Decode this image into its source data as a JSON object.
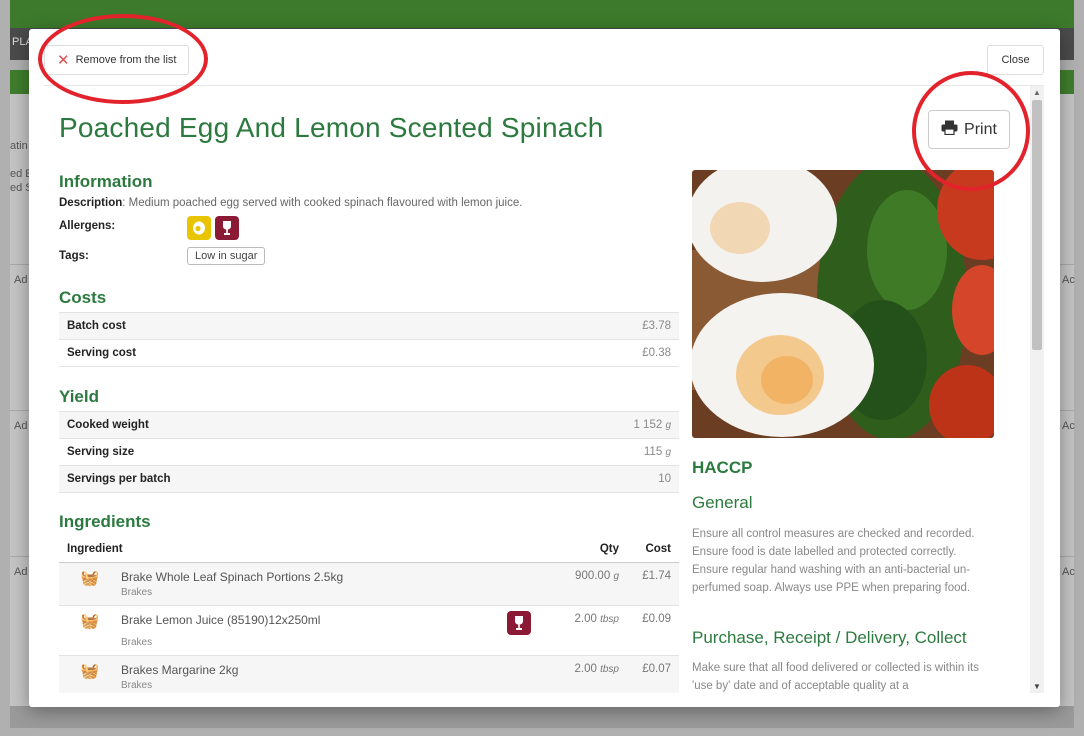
{
  "background": {
    "left_texts": [
      "atin",
      "ed E",
      "ed S",
      "Ad",
      "Ad",
      "Ad"
    ],
    "right_texts": [
      "Ac",
      "Ac",
      "Ac"
    ],
    "nav_fragment": "PLA"
  },
  "modal": {
    "remove_label": "Remove from the list",
    "close_label": "Close",
    "print_label": "Print",
    "title": "Poached Egg And Lemon Scented Spinach"
  },
  "information": {
    "heading": "Information",
    "description_label": "Description",
    "description": ": Medium poached egg served with cooked spinach flavoured with lemon juice.",
    "allergens_label": "Allergens:",
    "allergens": [
      {
        "name": "egg-allergen",
        "color": "#e9c500"
      },
      {
        "name": "sulphites-allergen",
        "color": "#8b1b35"
      }
    ],
    "tags_label": "Tags:",
    "tags": [
      "Low in sugar"
    ]
  },
  "costs": {
    "heading": "Costs",
    "rows": [
      {
        "label": "Batch cost",
        "value": "£3.78"
      },
      {
        "label": "Serving cost",
        "value": "£0.38"
      }
    ]
  },
  "yield": {
    "heading": "Yield",
    "rows": [
      {
        "label": "Cooked weight",
        "value": "1 152",
        "unit": "g"
      },
      {
        "label": "Serving size",
        "value": "115",
        "unit": "g"
      },
      {
        "label": "Servings per batch",
        "value": "10",
        "unit": ""
      }
    ]
  },
  "ingredients": {
    "heading": "Ingredients",
    "col_ingredient": "Ingredient",
    "col_qty": "Qty",
    "col_cost": "Cost",
    "rows": [
      {
        "name": "Brake Whole Leaf Spinach Portions 2.5kg",
        "supplier": "Brakes",
        "qty": "900.00",
        "unit": "g",
        "cost": "£1.74",
        "allergen": false
      },
      {
        "name": "Brake Lemon Juice (85190)12x250ml",
        "supplier": "Brakes",
        "qty": "2.00",
        "unit": "tbsp",
        "cost": "£0.09",
        "allergen": true
      },
      {
        "name": "Brakes Margarine 2kg",
        "supplier": "Brakes",
        "qty": "2.00",
        "unit": "tbsp",
        "cost": "£0.07",
        "allergen": false
      }
    ]
  },
  "haccp": {
    "heading": "HACCP",
    "general_heading": "General",
    "general_text": "Ensure all control measures are checked and recorded. Ensure food is date labelled and protected correctly. Ensure regular hand washing with an anti-bacterial un-perfumed soap. Always use PPE when preparing food.",
    "purchase_heading": "Purchase, Receipt / Delivery, Collect",
    "purchase_text": "Make sure that all food delivered or collected is within its 'use by' date and of acceptable quality at a"
  },
  "colors": {
    "brand_green": "#2c7a3f",
    "annotation_red": "#e3232b"
  }
}
